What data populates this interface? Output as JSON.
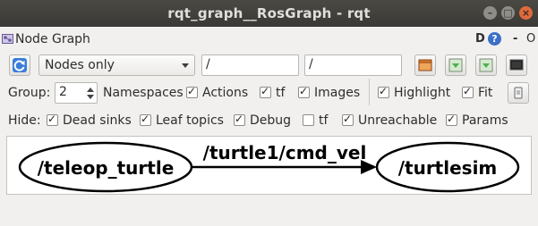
{
  "window": {
    "title": "rqt_graph__RosGraph - rqt"
  },
  "pane": {
    "title": "Node Graph",
    "d_label": "D",
    "help_label": "?",
    "minimize_label": "-",
    "float_label": "O"
  },
  "toolbar": {
    "mode_value": "Nodes only",
    "node_filter": "/",
    "topic_filter": "/"
  },
  "group": {
    "label": "Group:",
    "value": "2"
  },
  "options": {
    "namespaces": "Namespaces",
    "actions": "Actions",
    "tf": "tf",
    "images": "Images",
    "highlight": "Highlight",
    "fit": "Fit"
  },
  "hide": {
    "label": "Hide:",
    "dead_sinks": "Dead sinks",
    "leaf_topics": "Leaf topics",
    "debug": "Debug",
    "tf": "tf",
    "unreachable": "Unreachable",
    "params": "Params"
  },
  "checks": {
    "namespaces": true,
    "actions": true,
    "tf": true,
    "images": true,
    "highlight": true,
    "fit": true,
    "dead_sinks": true,
    "leaf_topics": true,
    "debug": true,
    "hide_tf": false,
    "unreachable": true,
    "params": true
  },
  "graph": {
    "node_left": "/teleop_turtle",
    "node_right": "/turtlesim",
    "edge_label": "/turtle1/cmd_vel"
  },
  "colors": {
    "refresh_blue": "#3b7dd8",
    "titlebar": "#3d3c38",
    "save_green": "#4caf50",
    "load_orange": "#e07b2a"
  }
}
